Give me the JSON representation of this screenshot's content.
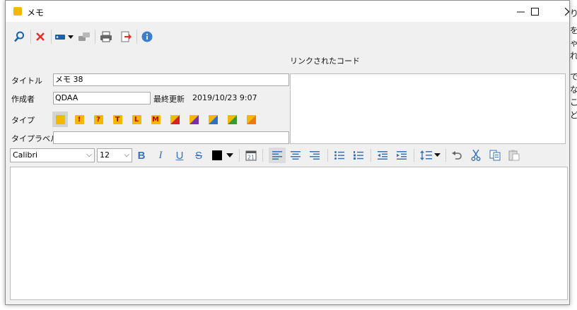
{
  "background": {
    "right_text": [
      "り、",
      "を",
      "ゃぞ",
      "れ",
      "でそ",
      "な",
      "こ",
      "ど"
    ]
  },
  "window": {
    "title": "メモ",
    "controls": {
      "minimize": "—",
      "maximize": "☐",
      "close": "✕"
    }
  },
  "toolbar": {
    "icons": [
      "search-icon",
      "delete-icon",
      "tag-dropdown-icon",
      "link-disabled-icon",
      "print-icon",
      "export-icon",
      "info-icon"
    ]
  },
  "form": {
    "linked_code_label": "リンクされたコード",
    "title_label": "タイトル",
    "title_value": "メモ 38",
    "author_label": "作成者",
    "author_value": "QDAA",
    "updated_label": "最終更新",
    "updated_value": "2019/10/23 9:07",
    "type_label": "タイプ",
    "type_label_label": "タイプラベル",
    "type_label_value": "",
    "types": [
      {
        "name": "plain",
        "glyph": "",
        "selected": true
      },
      {
        "name": "exclamation",
        "glyph": "!"
      },
      {
        "name": "question",
        "glyph": "?"
      },
      {
        "name": "t",
        "glyph": "T"
      },
      {
        "name": "l",
        "glyph": "L"
      },
      {
        "name": "m",
        "glyph": "M"
      },
      {
        "name": "red",
        "colors": [
          "#f5b800",
          "#d81f26"
        ]
      },
      {
        "name": "purple",
        "colors": [
          "#f5b800",
          "#7b2fa8"
        ]
      },
      {
        "name": "blue",
        "colors": [
          "#f5b800",
          "#2f6fc4"
        ]
      },
      {
        "name": "green",
        "colors": [
          "#f5b800",
          "#3a9a2a"
        ]
      },
      {
        "name": "orange",
        "colors": [
          "#f5b800",
          "#f07a10"
        ]
      }
    ]
  },
  "format": {
    "font": "Calibri",
    "size": "12",
    "bold": "B",
    "italic": "I",
    "underline": "U",
    "strike": "S",
    "color": "#000000"
  },
  "colors": {
    "accent_blue": "#3a72b8",
    "note_yellow": "#f5b800",
    "delete_red": "#e0302a"
  }
}
